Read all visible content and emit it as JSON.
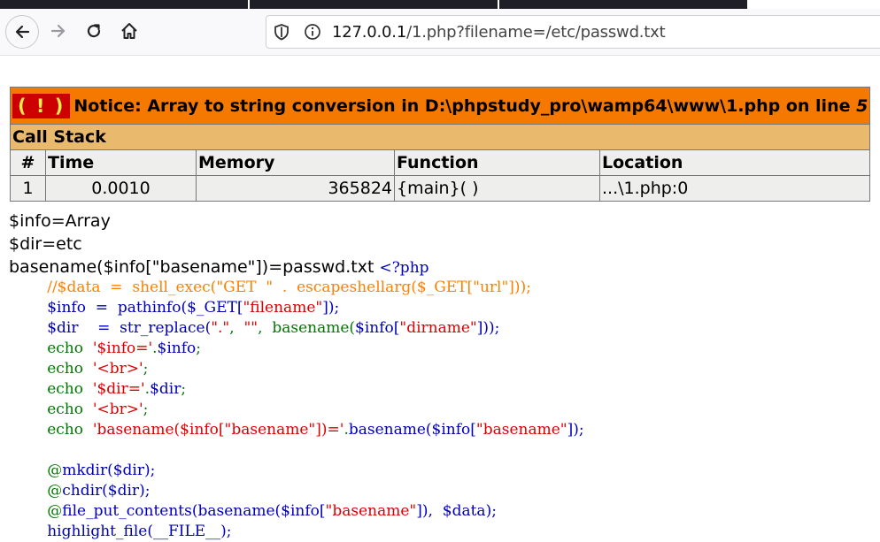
{
  "browser": {
    "url_host": "127.0.0.1",
    "url_path": "/1.php?filename=/etc/passwd.txt"
  },
  "notice": {
    "badge": "( ! )",
    "message": "Notice: Array to string conversion in D:\\phpstudy_pro\\wamp64\\www\\1.php on line ",
    "line": "5"
  },
  "callstack": {
    "title": "Call Stack",
    "headers": [
      "#",
      "Time",
      "Memory",
      "Function",
      "Location"
    ],
    "rows": [
      {
        "num": "1",
        "time": "0.0010",
        "memory": "365824",
        "function": "{main}( )",
        "location": "...\\1.php:0"
      }
    ]
  },
  "output": {
    "line1": "$info=Array",
    "line2": "$dir=etc",
    "line3": "basename($info[\"basename\"])=passwd.txt ",
    "php_open": "<?php"
  },
  "source": {
    "l1": "        //$data  =  shell_exec(\"GET  \"  .  escapeshellarg($_GET[\"url\"]));",
    "l2a": "        $info  =  pathinfo(",
    "l2b": "$_GET[",
    "l2c": "\"filename\"",
    "l2d": "]);",
    "l3a": "        $dir    =  str_replace(",
    "l3b": "\".\"",
    "l3c": ",  ",
    "l3d": "\"\"",
    "l3e": ",  basename(",
    "l3f": "$info[",
    "l3g": "\"dirname\"",
    "l3h": "]));",
    "l4a": "        echo  ",
    "l4b": "'$info='",
    "l4c": ".",
    "l4d": "$info",
    "l4e": ";",
    "l5a": "        echo  ",
    "l5b": "'<br>'",
    "l5c": ";",
    "l6a": "        echo  ",
    "l6b": "'$dir='",
    "l6c": ".",
    "l6d": "$dir",
    "l6e": ";",
    "l7a": "        echo  ",
    "l7b": "'<br>'",
    "l7c": ";",
    "l8a": "        echo  ",
    "l8b": "'basename($info[\"basename\"])='",
    "l8c": ".",
    "l8d": "basename(",
    "l8e": "$info[",
    "l8f": "\"basename\"",
    "l8g": "]);",
    "l10a": "        @",
    "l10b": "mkdir(",
    "l10c": "$dir",
    "l10d": ");",
    "l11a": "        @",
    "l11b": "chdir(",
    "l11c": "$dir",
    "l11d": ");",
    "l12a": "        @",
    "l12b": "file_put_contents(basename(",
    "l12c": "$info[",
    "l12d": "\"basename\"",
    "l12e": "]),  ",
    "l12f": "$data",
    "l12g": ");",
    "l13": "        highlight_file(__FILE__);"
  }
}
